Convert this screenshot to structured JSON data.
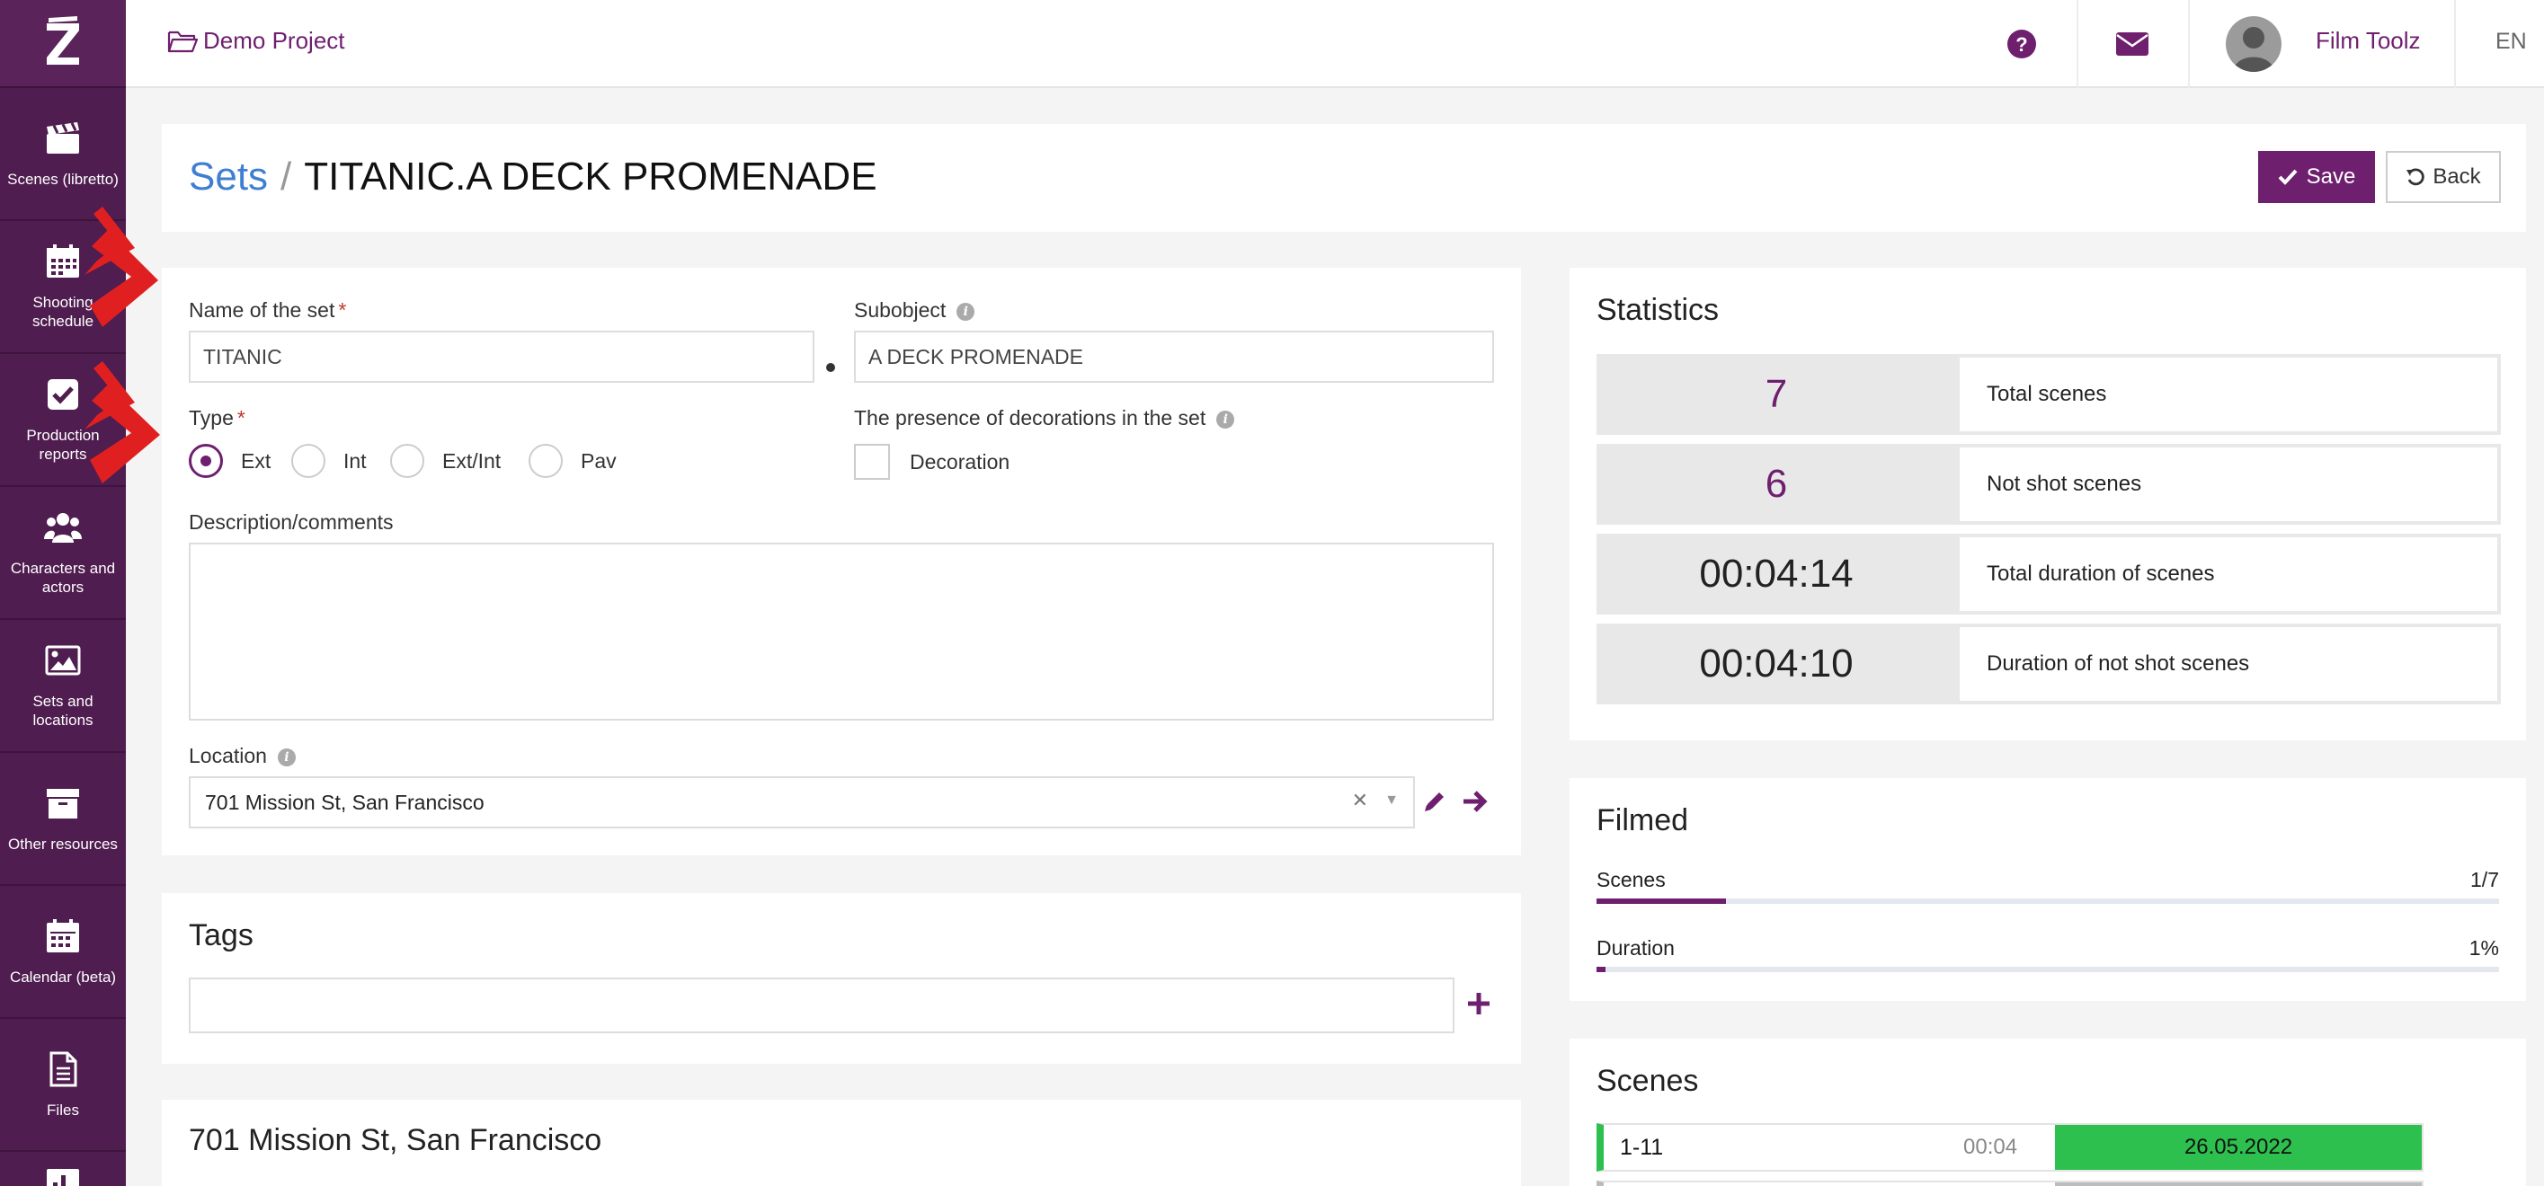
{
  "sidebar": {
    "items": [
      {
        "label": "Scenes (libretto)",
        "icon": "clapperboard-icon"
      },
      {
        "label": "Shooting schedule",
        "icon": "calendar-grid-icon"
      },
      {
        "label": "Production reports",
        "icon": "checkbox-icon"
      },
      {
        "label": "Characters and actors",
        "icon": "users-icon"
      },
      {
        "label": "Sets and locations",
        "icon": "image-icon"
      },
      {
        "label": "Other resources",
        "icon": "archive-box-icon"
      },
      {
        "label": "Calendar (beta)",
        "icon": "calendar-icon"
      },
      {
        "label": "Files",
        "icon": "file-icon"
      }
    ]
  },
  "topbar": {
    "project": "Demo Project",
    "username": "Film Toolz",
    "language": "EN"
  },
  "header": {
    "breadcrumb_link": "Sets",
    "breadcrumb_sep": "/",
    "title": "TITANIC.A DECK PROMENADE",
    "save_label": "Save",
    "back_label": "Back"
  },
  "form": {
    "name_label": "Name of the set",
    "name_value": "TITANIC",
    "subobject_label": "Subobject",
    "subobject_value": "A DECK PROMENADE",
    "type_label": "Type",
    "required_mark": "*",
    "type_options": [
      "Ext",
      "Int",
      "Ext/Int",
      "Pav"
    ],
    "type_selected": "Ext",
    "decorations_label": "The presence of decorations in the set",
    "decoration_checkbox_label": "Decoration",
    "description_label": "Description/comments",
    "description_value": "",
    "location_label": "Location",
    "location_value": "701 Mission St, San Francisco"
  },
  "tags": {
    "title": "Tags"
  },
  "address_panel": {
    "title": "701 Mission St, San Francisco"
  },
  "statistics": {
    "title": "Statistics",
    "rows": [
      {
        "value": "7",
        "label": "Total scenes",
        "color": "#6e1f6e"
      },
      {
        "value": "6",
        "label": "Not shot scenes",
        "color": "#6e1f6e"
      },
      {
        "value": "00:04:14",
        "label": "Total duration of scenes",
        "color": "#222222"
      },
      {
        "value": "00:04:10",
        "label": "Duration of not shot scenes",
        "color": "#222222"
      }
    ]
  },
  "filmed": {
    "title": "Filmed",
    "scenes_label": "Scenes",
    "scenes_value": "1/7",
    "scenes_fraction": 0.143,
    "duration_label": "Duration",
    "duration_value": "1%",
    "duration_fraction": 0.01
  },
  "scenes": {
    "title": "Scenes",
    "rows": [
      {
        "id": "1-11",
        "duration": "00:04",
        "date": "26.05.2022"
      }
    ]
  },
  "colors": {
    "brand": "#6e1f6e",
    "sidebar": "#4f1d4f",
    "link": "#3f7fd1",
    "scene_shot": "#2ec04e"
  }
}
